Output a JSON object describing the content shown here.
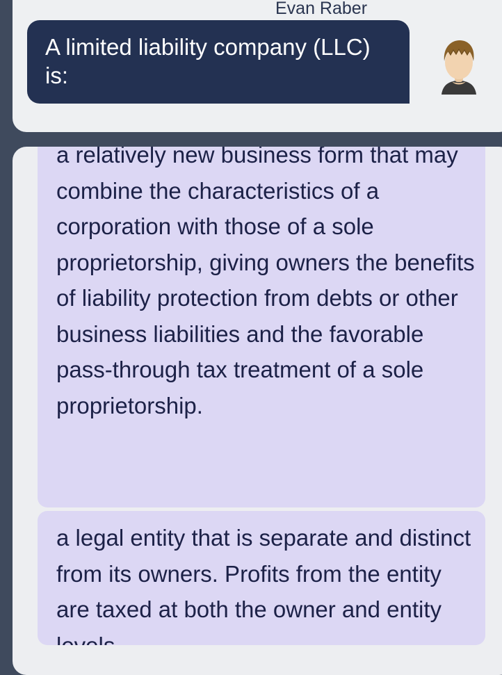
{
  "question": {
    "author": "Evan Raber",
    "text": "A limited liability company (LLC) is:"
  },
  "answers": [
    {
      "text": "a relatively new business form that may combine the characteristics of a corporation with those of a sole proprietorship, giving owners the benefits of liability protection from debts or other business liabilities and the favorable pass-through tax treatment of a sole proprietorship."
    },
    {
      "text": "a legal entity that is separate and distinct from its owners. Profits from the entity are taxed at both the owner and entity levels."
    }
  ],
  "colors": {
    "page_background": "#3f4a5d",
    "card_background": "#eef0f2",
    "question_bubble": "#233152",
    "answer_background": "#dcd7f4",
    "answer_text": "#1c2147"
  },
  "icons": {
    "avatar": "user-avatar-icon"
  }
}
